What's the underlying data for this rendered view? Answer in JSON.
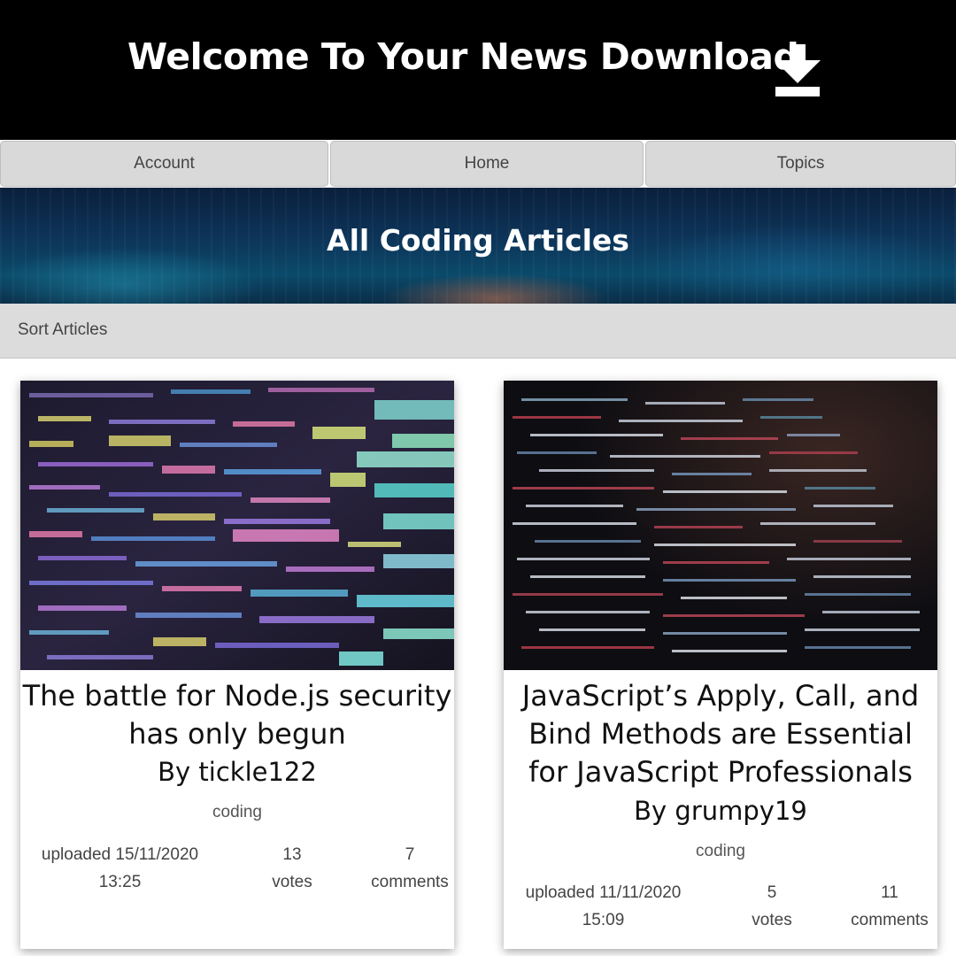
{
  "header": {
    "title": "Welcome To Your News Download",
    "icon": "download-icon"
  },
  "nav": {
    "items": [
      {
        "label": "Account"
      },
      {
        "label": "Home"
      },
      {
        "label": "Topics"
      }
    ]
  },
  "banner": {
    "title": "All Coding Articles"
  },
  "sort": {
    "label": "Sort Articles"
  },
  "articles": [
    {
      "title_lines": [
        "The battle for Node.js security",
        "has only begun"
      ],
      "author": "By tickle122",
      "topic": "coding",
      "uploaded_line1": "uploaded 15/11/2020",
      "uploaded_line2": "13:25",
      "votes_count": "13",
      "votes_label": "votes",
      "comments_count": "7",
      "comments_label": "comments",
      "image": "colorful-code-screen"
    },
    {
      "title_lines": [
        "JavaScript’s Apply, Call, and",
        "Bind Methods are Essential",
        "for JavaScript Professionals"
      ],
      "author": "By grumpy19",
      "topic": "coding",
      "uploaded_line1": "uploaded 11/11/2020",
      "uploaded_line2": "15:09",
      "votes_count": "5",
      "votes_label": "votes",
      "comments_count": "11",
      "comments_label": "comments",
      "image": "dark-code-screen"
    }
  ],
  "colors": {
    "header_bg": "#000000",
    "nav_bg": "#d9d9d9",
    "sortbar_bg": "#dcdcdc",
    "banner_bg": "#0d355a"
  }
}
